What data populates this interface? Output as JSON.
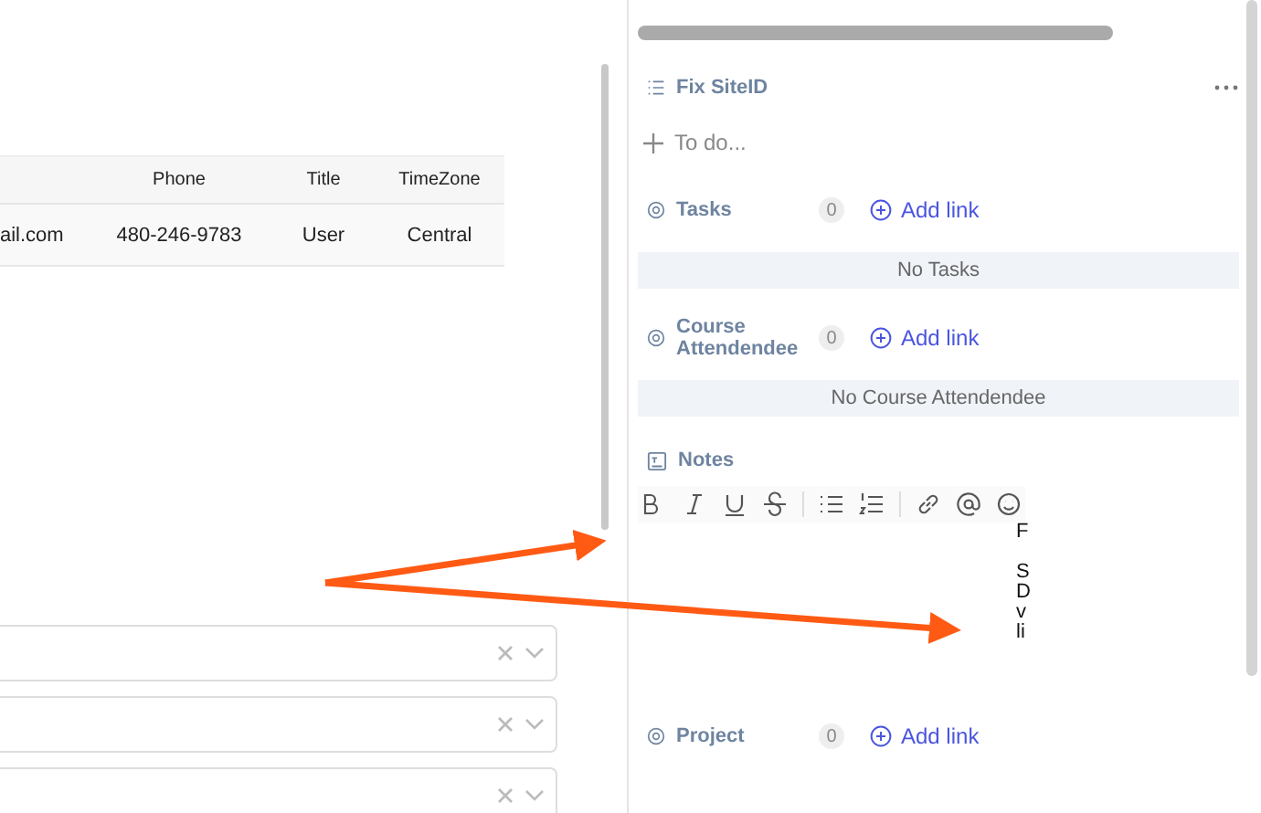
{
  "table": {
    "columns": [
      "Phone",
      "Title",
      "TimeZone"
    ],
    "rows": [
      {
        "email": "ail.com",
        "phone": "480-246-9783",
        "title": "User",
        "timezone": "Central"
      }
    ]
  },
  "selects": [
    {
      "clearable": true
    },
    {
      "clearable": true
    },
    {
      "clearable": true
    }
  ],
  "panel": {
    "title": "Fix SiteID",
    "todo_placeholder": "To do...",
    "sections": [
      {
        "label": "Tasks",
        "count": "0",
        "action": "Add link",
        "empty": "No Tasks"
      },
      {
        "label": "Course Attendendee",
        "count": "0",
        "action": "Add link",
        "empty": "No Course Attendendee"
      }
    ],
    "notes": {
      "label": "Notes",
      "paragraphs": [
        {
          "lines": [
            "F"
          ]
        },
        {
          "lines": [
            "S",
            "D",
            "v",
            "li"
          ]
        }
      ]
    },
    "project": {
      "label": "Project",
      "count": "0",
      "action": "Add link"
    }
  }
}
